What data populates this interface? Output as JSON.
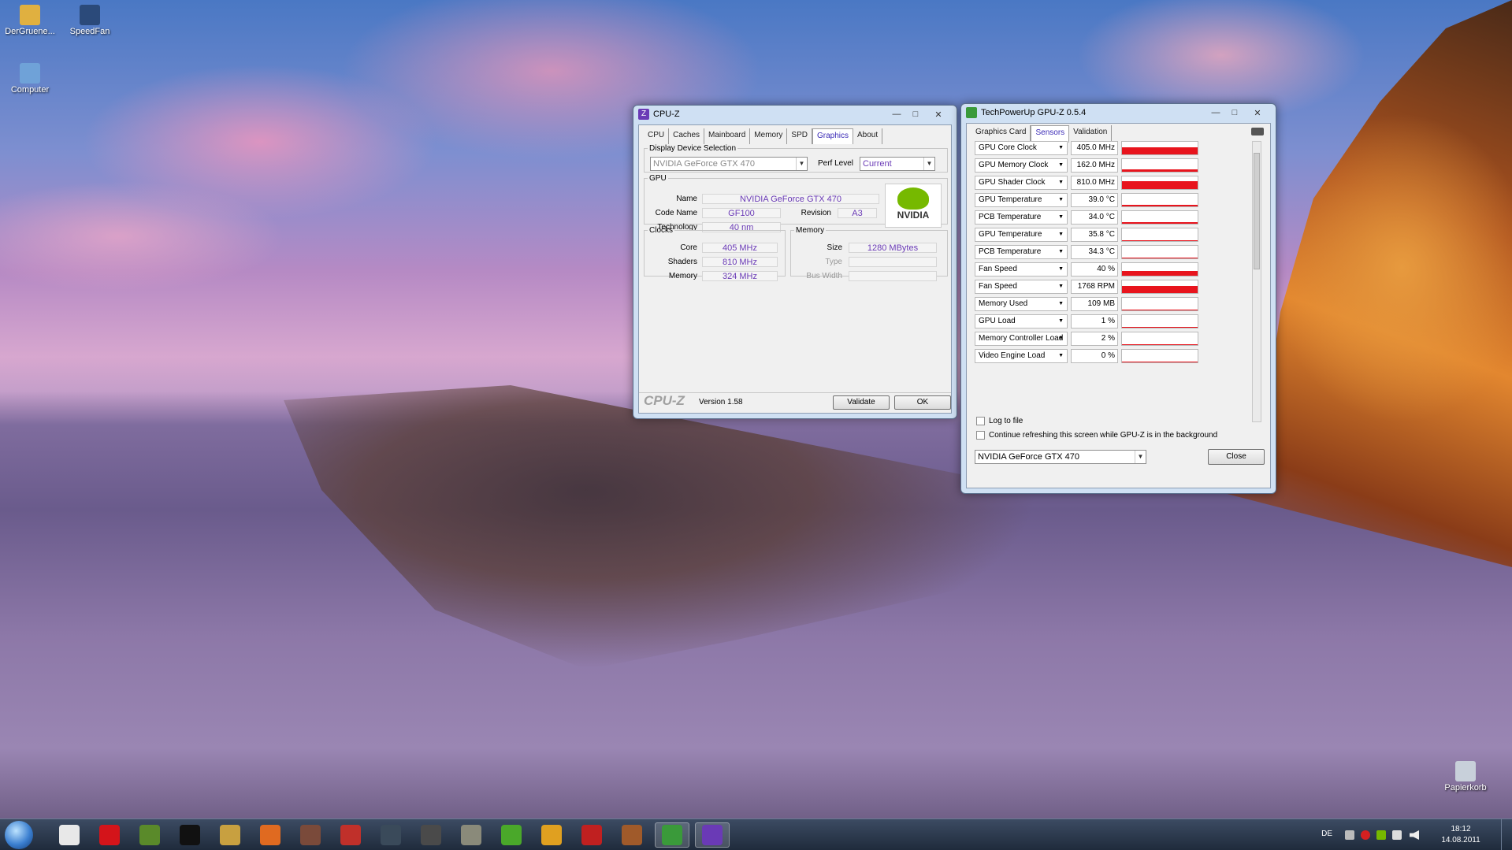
{
  "desktop": {
    "icons": [
      {
        "label": "DerGruene...",
        "color": "#e0b040"
      },
      {
        "label": "SpeedFan",
        "color": "#2b4a7a"
      },
      {
        "label": "Computer",
        "color": "#6fa2d8"
      },
      {
        "label": "Papierkorb",
        "color": "#c8d0da"
      }
    ]
  },
  "cpuz": {
    "title": "CPU-Z",
    "tabs": [
      "CPU",
      "Caches",
      "Mainboard",
      "Memory",
      "SPD",
      "Graphics",
      "About"
    ],
    "active_tab": "Graphics",
    "display_device_label": "Display Device Selection",
    "device": "NVIDIA GeForce GTX 470",
    "perf_level_label": "Perf Level",
    "perf_level": "Current",
    "gpu_group": "GPU",
    "name_label": "Name",
    "name": "NVIDIA GeForce GTX 470",
    "codename_label": "Code Name",
    "codename": "GF100",
    "revision_label": "Revision",
    "revision": "A3",
    "technology_label": "Technology",
    "technology": "40 nm",
    "vendor_logo": "NVIDIA",
    "clocks_group": "Clocks",
    "core_label": "Core",
    "core": "405 MHz",
    "shaders_label": "Shaders",
    "shaders": "810 MHz",
    "memory_clock_label": "Memory",
    "memory_clock": "324 MHz",
    "memory_group": "Memory",
    "size_label": "Size",
    "size": "1280 MBytes",
    "type_label": "Type",
    "type": "",
    "buswidth_label": "Bus Width",
    "buswidth": "",
    "brand": "CPU-Z",
    "version": "Version 1.58",
    "validate_label": "Validate",
    "ok_label": "OK"
  },
  "gpuz": {
    "title": "TechPowerUp GPU-Z 0.5.4",
    "tabs": [
      "Graphics Card",
      "Sensors",
      "Validation"
    ],
    "active_tab": "Sensors",
    "sensors": [
      {
        "name": "GPU Core Clock",
        "value": "405.0 MHz",
        "level": 0.55
      },
      {
        "name": "GPU Memory Clock",
        "value": "162.0 MHz",
        "level": 0.2
      },
      {
        "name": "GPU Shader Clock",
        "value": "810.0 MHz",
        "level": 0.6
      },
      {
        "name": "GPU Temperature",
        "value": "39.0 °C",
        "level": 0.1
      },
      {
        "name": "PCB Temperature",
        "value": "34.0 °C",
        "level": 0.1
      },
      {
        "name": "GPU Temperature",
        "value": "35.8 °C",
        "level": 0.08
      },
      {
        "name": "PCB Temperature",
        "value": "34.3 °C",
        "level": 0.08
      },
      {
        "name": "Fan Speed",
        "value": "40 %",
        "level": 0.35
      },
      {
        "name": "Fan Speed",
        "value": "1768 RPM",
        "level": 0.55
      },
      {
        "name": "Memory Used",
        "value": "109 MB",
        "level": 0.08
      },
      {
        "name": "GPU Load",
        "value": "1 %",
        "level": 0.02
      },
      {
        "name": "Memory Controller Load",
        "value": "2 %",
        "level": 0.03
      },
      {
        "name": "Video Engine Load",
        "value": "0 %",
        "level": 0
      }
    ],
    "log_to_file_label": "Log to file",
    "continue_label": "Continue refreshing this screen while GPU-Z is in the background",
    "device": "NVIDIA GeForce GTX 470",
    "close_label": "Close"
  },
  "taskbar": {
    "apps": [
      {
        "name": "wolf-app",
        "color": "#e8e8e8",
        "open": false
      },
      {
        "name": "opera-browser",
        "color": "#d4141a",
        "open": false
      },
      {
        "name": "minecraft",
        "color": "#5a8a2a",
        "open": false
      },
      {
        "name": "command-prompt",
        "color": "#111111",
        "open": false
      },
      {
        "name": "game-shield-app",
        "color": "#c8a040",
        "open": false
      },
      {
        "name": "orange-shield-app",
        "color": "#e06a20",
        "open": false
      },
      {
        "name": "fighter-game",
        "color": "#7a4a3a",
        "open": false
      },
      {
        "name": "crossfire-game",
        "color": "#c0302a",
        "open": false
      },
      {
        "name": "counter-strike",
        "color": "#3a4a5a",
        "open": false
      },
      {
        "name": "soldier-game",
        "color": "#4a4a4a",
        "open": false
      },
      {
        "name": "robot-game",
        "color": "#8a8a7a",
        "open": false
      },
      {
        "name": "utorrent",
        "color": "#4aa82a",
        "open": false
      },
      {
        "name": "two-worlds-game",
        "color": "#e0a020",
        "open": false
      },
      {
        "name": "borderlands",
        "color": "#c02020",
        "open": false
      },
      {
        "name": "pixel-game",
        "color": "#a05a2a",
        "open": false
      },
      {
        "name": "gpuz-taskbar",
        "color": "#3a9a3a",
        "open": true
      },
      {
        "name": "cpuz-taskbar",
        "color": "#6a3ab6",
        "open": true
      }
    ],
    "language": "DE",
    "time": "18:12",
    "date": "14.08.2011"
  }
}
